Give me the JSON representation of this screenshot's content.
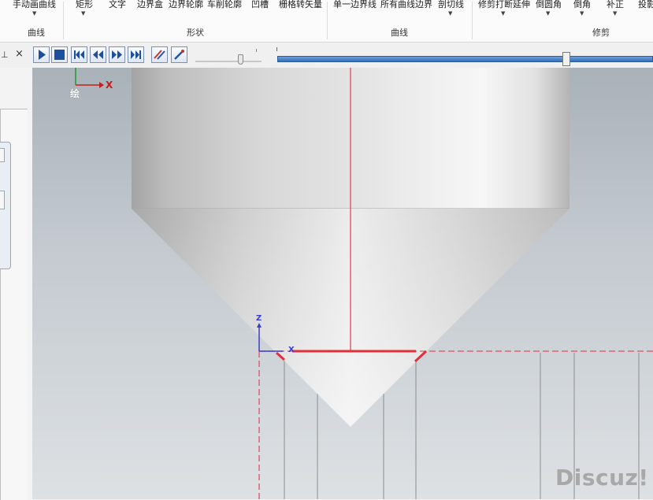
{
  "ribbon": {
    "items": [
      {
        "label": "手动画曲线",
        "dropdown": true
      },
      {
        "label": "矩形",
        "dropdown": true
      },
      {
        "label": "文字",
        "dropdown": false
      },
      {
        "label": "边界盒",
        "dropdown": false
      },
      {
        "label": "边界轮廓",
        "dropdown": false
      },
      {
        "label": "车削轮廓",
        "dropdown": false
      },
      {
        "label": "凹槽",
        "dropdown": false
      },
      {
        "label": "栅格转矢量",
        "dropdown": false
      },
      {
        "label": "单一边界线",
        "dropdown": false
      },
      {
        "label": "所有曲线边界",
        "dropdown": false
      },
      {
        "label": "剖切线",
        "dropdown": true
      },
      {
        "label": "修剪打断延伸",
        "dropdown": true
      },
      {
        "label": "倒圆角",
        "dropdown": true
      },
      {
        "label": "倒角",
        "dropdown": true
      },
      {
        "label": "补正",
        "dropdown": true
      },
      {
        "label": "投影",
        "dropdown": false
      }
    ],
    "groups": [
      "曲线",
      "形状",
      "曲线",
      "修剪"
    ]
  },
  "panel": {
    "pin_glyph": "⊥",
    "close_glyph": "×"
  },
  "toolbar": {
    "buttons": [
      "play-icon",
      "stop-icon",
      "skip-first-icon",
      "step-back-icon",
      "step-forward-icon",
      "skip-last-icon",
      "trace-icon",
      "tool-icon"
    ],
    "progress_fraction": 0.77
  },
  "viewport": {
    "top_axis_x": "X",
    "view_label": "绘",
    "wcs_z": "Z",
    "wcs_x": "X"
  },
  "watermark": "Discuz!"
}
